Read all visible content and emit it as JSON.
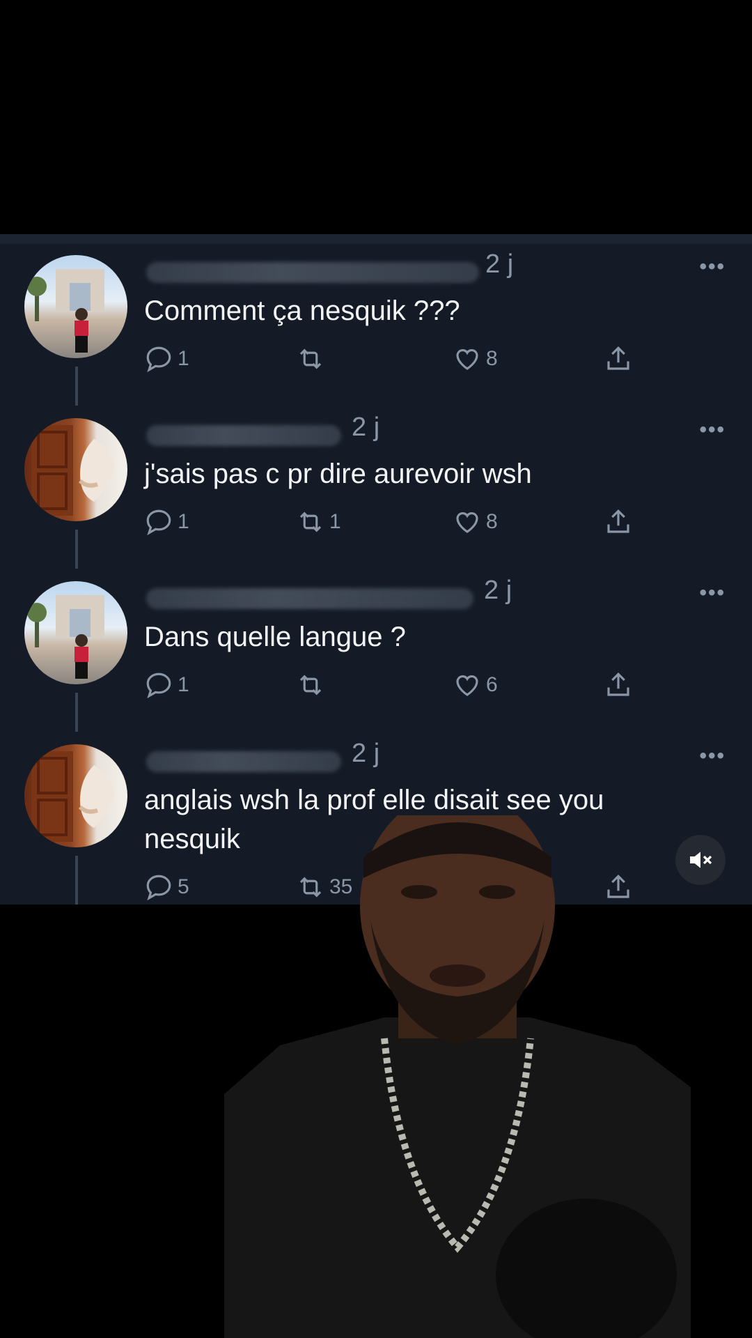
{
  "tweets": [
    {
      "avatar": "arc-de-triomphe-photo",
      "time": "2 j",
      "text": "Comment ça nesquik ???",
      "replies": "1",
      "retweets": "",
      "likes": "8"
    },
    {
      "avatar": "wooden-door-photo",
      "time": "2 j",
      "text": "j'sais pas c pr dire aurevoir wsh",
      "replies": "1",
      "retweets": "1",
      "likes": "8"
    },
    {
      "avatar": "arc-de-triomphe-photo",
      "time": "2 j",
      "text": "Dans quelle langue ?",
      "replies": "1",
      "retweets": "",
      "likes": "6"
    },
    {
      "avatar": "wooden-door-photo",
      "time": "2 j",
      "text": "anglais wsh la prof elle disait see you nesquik",
      "replies": "5",
      "retweets": "35",
      "likes": ""
    }
  ],
  "more_label": "•••",
  "colors": {
    "background": "#141b26",
    "text": "#f2f4f6",
    "muted": "#8b97a6",
    "thread_line": "#3a4452"
  },
  "icons": [
    "reply-icon",
    "retweet-icon",
    "heart-icon",
    "share-icon",
    "more-icon",
    "mute-icon"
  ]
}
